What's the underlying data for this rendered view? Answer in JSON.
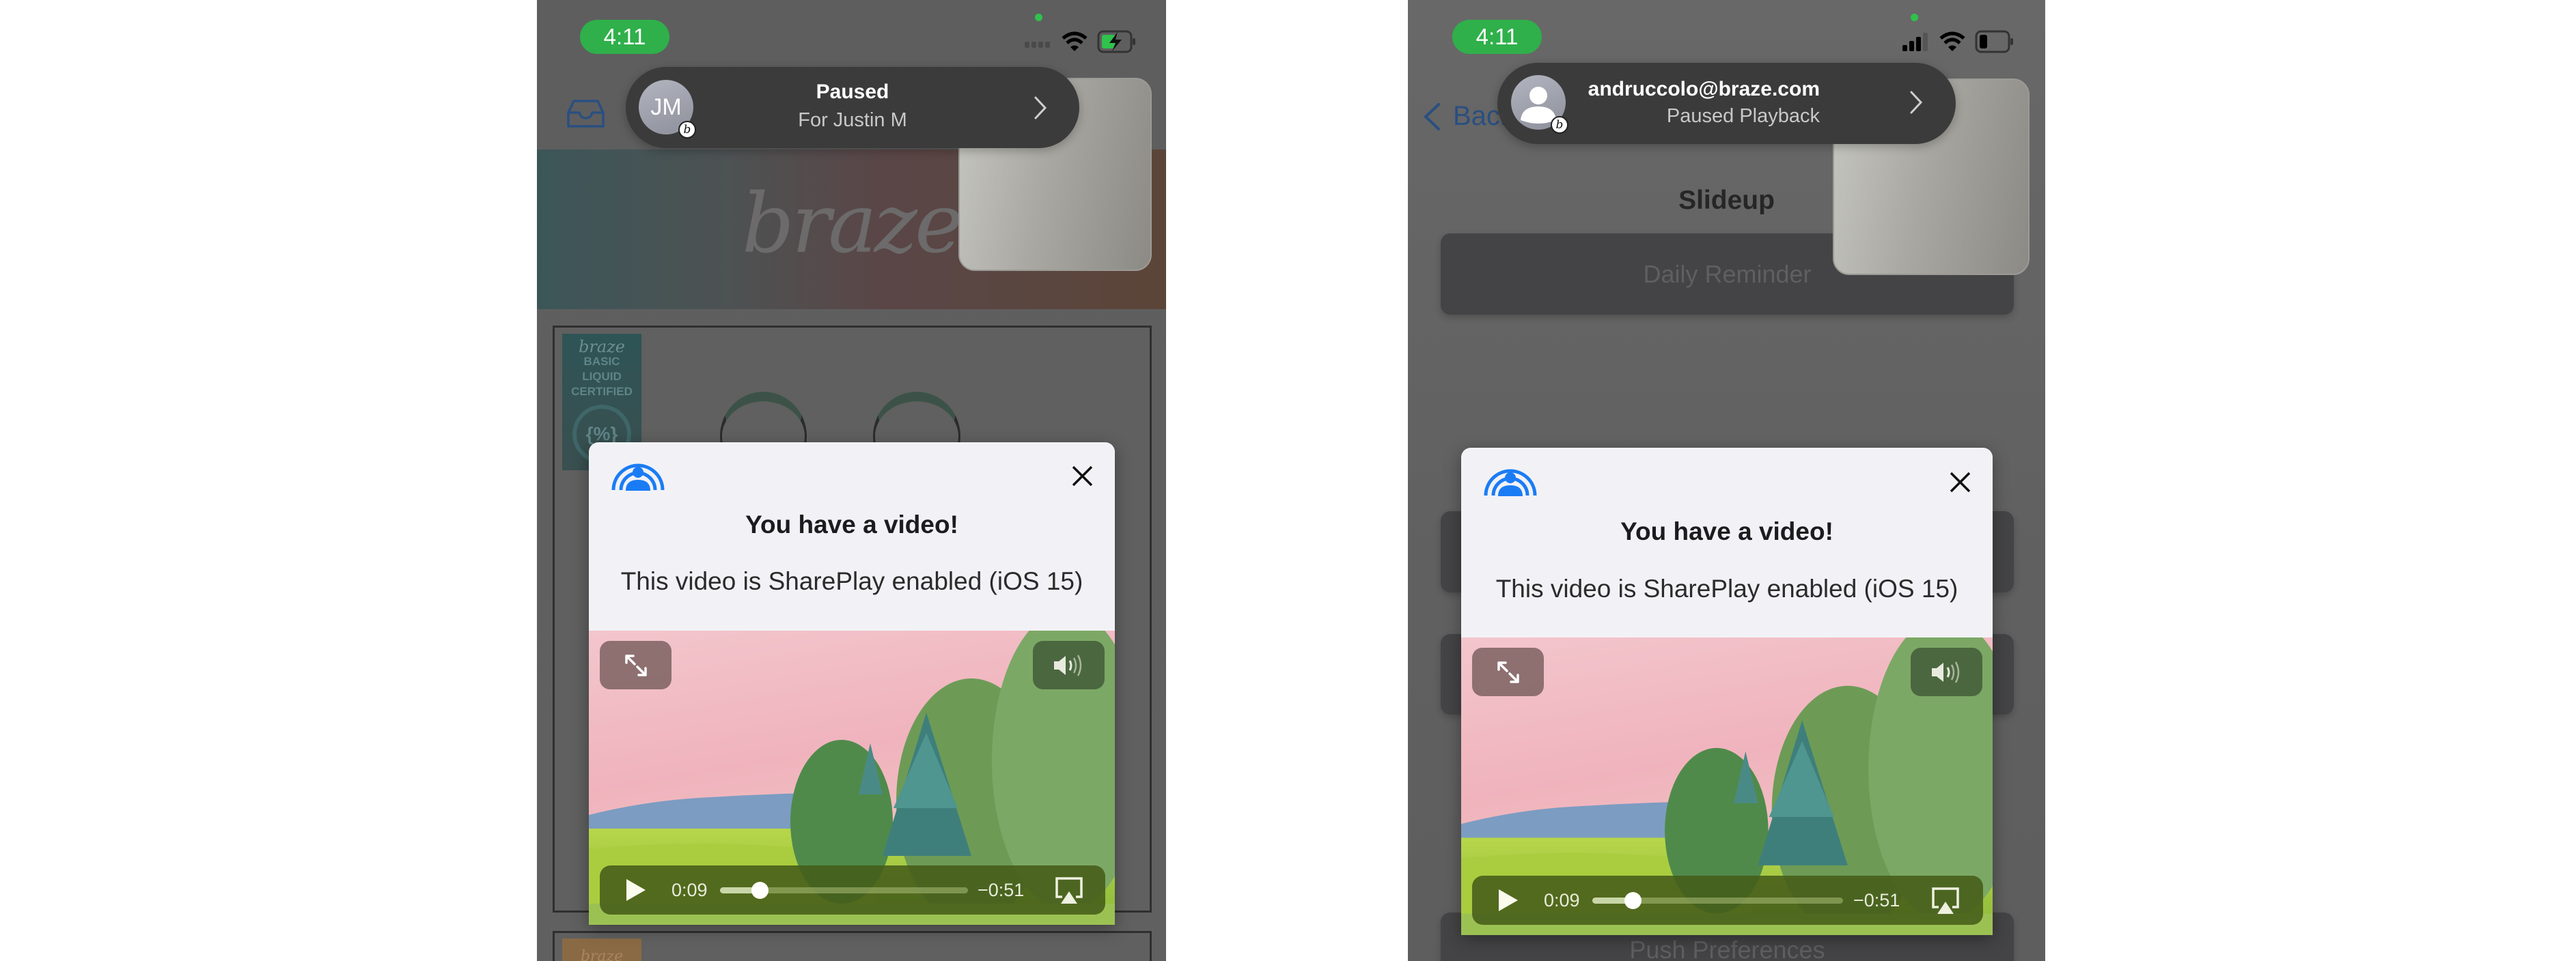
{
  "left_phone": {
    "status": {
      "time": "4:11"
    },
    "banner": {
      "avatar_initials": "JM",
      "title": "Paused",
      "subtitle": "For Justin M",
      "app_badge": "b"
    },
    "hero": {
      "logo": "braze"
    },
    "badge": {
      "brand": "braze",
      "line1": "BASIC",
      "line2": "LIQUID",
      "line3": "CERTIFIED",
      "symbol": "{%}"
    },
    "bottom_card": {
      "brand": "braze"
    },
    "modal": {
      "title": "You have a video!",
      "body": "This video is SharePlay enabled (iOS 15)",
      "video": {
        "current_time": "0:09",
        "remaining_time": "−0:51",
        "progress": 0.16
      }
    }
  },
  "right_phone": {
    "status": {
      "time": "4:11"
    },
    "nav": {
      "back_label": "Back"
    },
    "banner": {
      "title": "andruccolo@braze.com",
      "subtitle": "Paused Playback",
      "app_badge": "b"
    },
    "page_title": "Slideup",
    "buttons": {
      "daily_reminder": "Daily Reminder",
      "push_preferences": "Push Preferences"
    },
    "modal": {
      "title": "You have a video!",
      "body": "This video is SharePlay enabled (iOS 15)",
      "video": {
        "current_time": "0:09",
        "remaining_time": "−0:51",
        "progress": 0.16
      }
    }
  },
  "colors": {
    "status_green": "#2fb04a",
    "shareplay_blue": "#1a7cf5",
    "banner_bg": "#3b3b3b"
  }
}
